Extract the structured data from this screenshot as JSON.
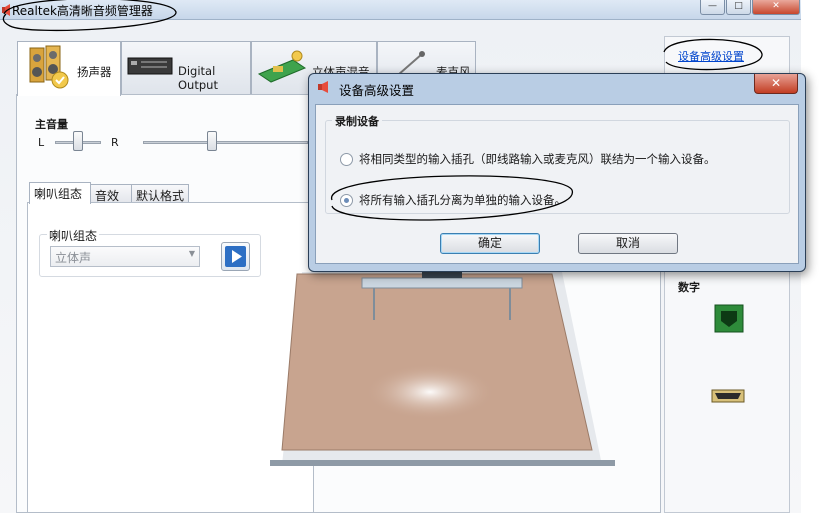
{
  "window": {
    "title": "Realtek高清晰音频管理器",
    "controls": {
      "minimize": "—",
      "maximize": "□",
      "close": "✕"
    }
  },
  "device_tabs": [
    {
      "label": "扬声器",
      "icon": "speaker-icon",
      "active": true
    },
    {
      "label": "Digital Output",
      "icon": "digital-output-icon",
      "active": false
    },
    {
      "label": "立体声混音",
      "icon": "stereo-mix-icon",
      "active": false
    },
    {
      "label": "麦克风",
      "icon": "microphone-icon",
      "active": false
    }
  ],
  "volume": {
    "label": "主音量",
    "left": "L",
    "right": "R"
  },
  "sub_tabs": [
    {
      "label": "喇叭组态",
      "active": true
    },
    {
      "label": "音效",
      "active": false
    },
    {
      "label": "默认格式",
      "active": false
    }
  ],
  "speaker_config": {
    "group_label": "喇叭组态",
    "selected": "立体声"
  },
  "right_panel": {
    "advanced_link": "设备高级设置",
    "digital_label": "数字"
  },
  "dialog": {
    "title": "设备高级设置",
    "group_label": "录制设备",
    "options": [
      {
        "label": "将相同类型的输入插孔（即线路输入或麦克风）联结为一个输入设备。",
        "checked": false
      },
      {
        "label": "将所有输入插孔分离为单独的输入设备。",
        "checked": true
      }
    ],
    "ok": "确定",
    "cancel": "取消"
  },
  "colors": {
    "link": "#0044cc",
    "dialog_frame": "#b9cde4",
    "digital_port": "#2e8b3a",
    "floor": "#c8a48f"
  }
}
